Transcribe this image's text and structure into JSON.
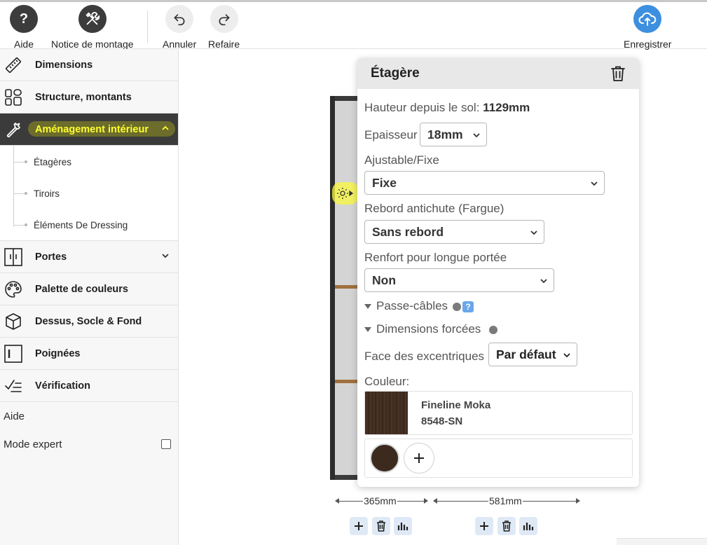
{
  "toolbar": {
    "help_label": "Aide",
    "manual_label": "Notice de montage",
    "undo_label": "Annuler",
    "redo_label": "Refaire",
    "save_label": "Enregistrer",
    "help_glyph": "?"
  },
  "sidebar": {
    "items": [
      {
        "label": "Dimensions",
        "icon": "ruler-icon"
      },
      {
        "label": "Structure, montants",
        "icon": "layout-icon"
      },
      {
        "label": "Aménagement intérieur",
        "icon": "wrench-icon"
      },
      {
        "label": "Portes",
        "icon": "doors-icon"
      },
      {
        "label": "Palette de couleurs",
        "icon": "palette-icon"
      },
      {
        "label": "Dessus, Socle & Fond",
        "icon": "cube-icon"
      },
      {
        "label": "Poignées",
        "icon": "handle-icon"
      },
      {
        "label": "Vérification",
        "icon": "check-icon"
      }
    ],
    "submenu": [
      "Étagères",
      "Tiroirs",
      "Éléments De Dressing"
    ],
    "help": "Aide",
    "expert_mode": "Mode expert"
  },
  "panel": {
    "title": "Étagère",
    "height_label": "Hauteur depuis le sol:",
    "height_value": "1129mm",
    "thickness_label": "Epaisseur",
    "thickness_value": "18mm",
    "adjustable_label": "Ajustable/Fixe",
    "adjustable_value": "Fixe",
    "ledge_label": "Rebord antichute (Fargue)",
    "ledge_value": "Sans rebord",
    "reinforce_label": "Renfort pour longue portée",
    "reinforce_value": "Non",
    "cable_label": "Passe-câbles",
    "cable_help": "?",
    "forced_label": "Dimensions forcées",
    "face_label": "Face des excentriques",
    "face_value": "Par défaut",
    "color_label": "Couleur:",
    "color_name": "Fineline Moka",
    "color_code": "8548-SN",
    "color_hex": "#3d2a1f"
  },
  "dimensions": {
    "left": "365mm",
    "right": "581mm"
  }
}
